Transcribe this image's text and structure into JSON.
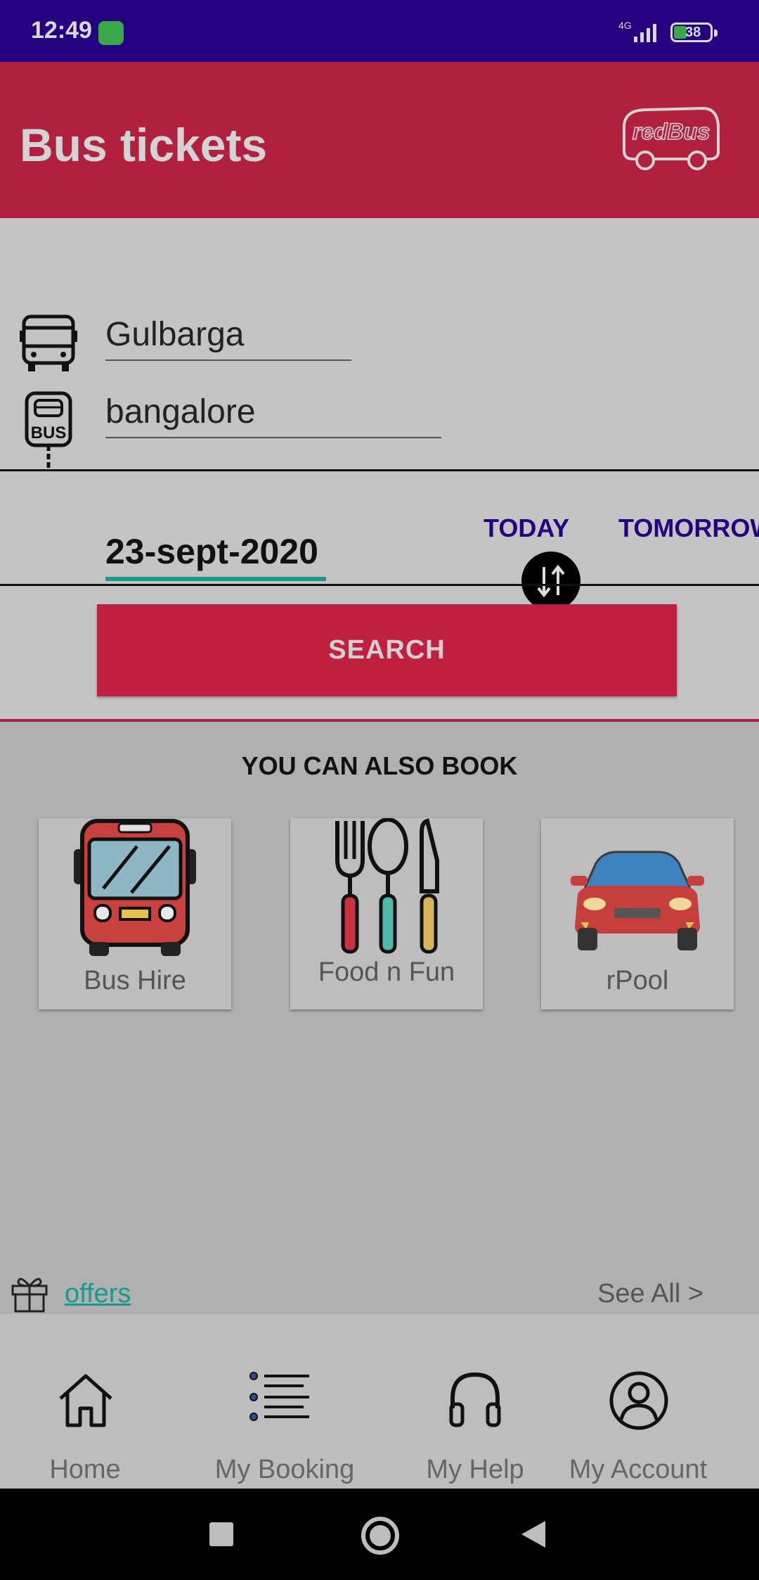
{
  "status_bar": {
    "time": "12:49",
    "network": "4G",
    "battery": "38"
  },
  "header": {
    "title": "Bus tickets",
    "logo_text": "redBus"
  },
  "search": {
    "from_value": "Gulbarga",
    "to_value": "bangalore",
    "date_value": "23-sept-2020",
    "today_label": "TODAY",
    "tomorrow_label": "TOMORROW",
    "search_label": "SEARCH"
  },
  "also_book": {
    "title": "YOU CAN ALSO BOOK",
    "items": [
      {
        "label": "Bus Hire",
        "icon": "bus-hire-icon"
      },
      {
        "label": "Food n Fun",
        "icon": "cutlery-icon"
      },
      {
        "label": "rPool",
        "icon": "car-icon"
      }
    ]
  },
  "offers": {
    "label": "offers",
    "see_all": "See All >"
  },
  "bottom_nav": [
    {
      "label": "Home",
      "icon": "home-icon"
    },
    {
      "label": "My Booking",
      "icon": "list-icon"
    },
    {
      "label": "My Help",
      "icon": "headset-icon"
    },
    {
      "label": "My Account",
      "icon": "account-icon"
    }
  ],
  "colors": {
    "brand": "#b1203e",
    "status_bar": "#25017f",
    "accent": "#1a9a8a",
    "link_blue": "#25017f"
  }
}
